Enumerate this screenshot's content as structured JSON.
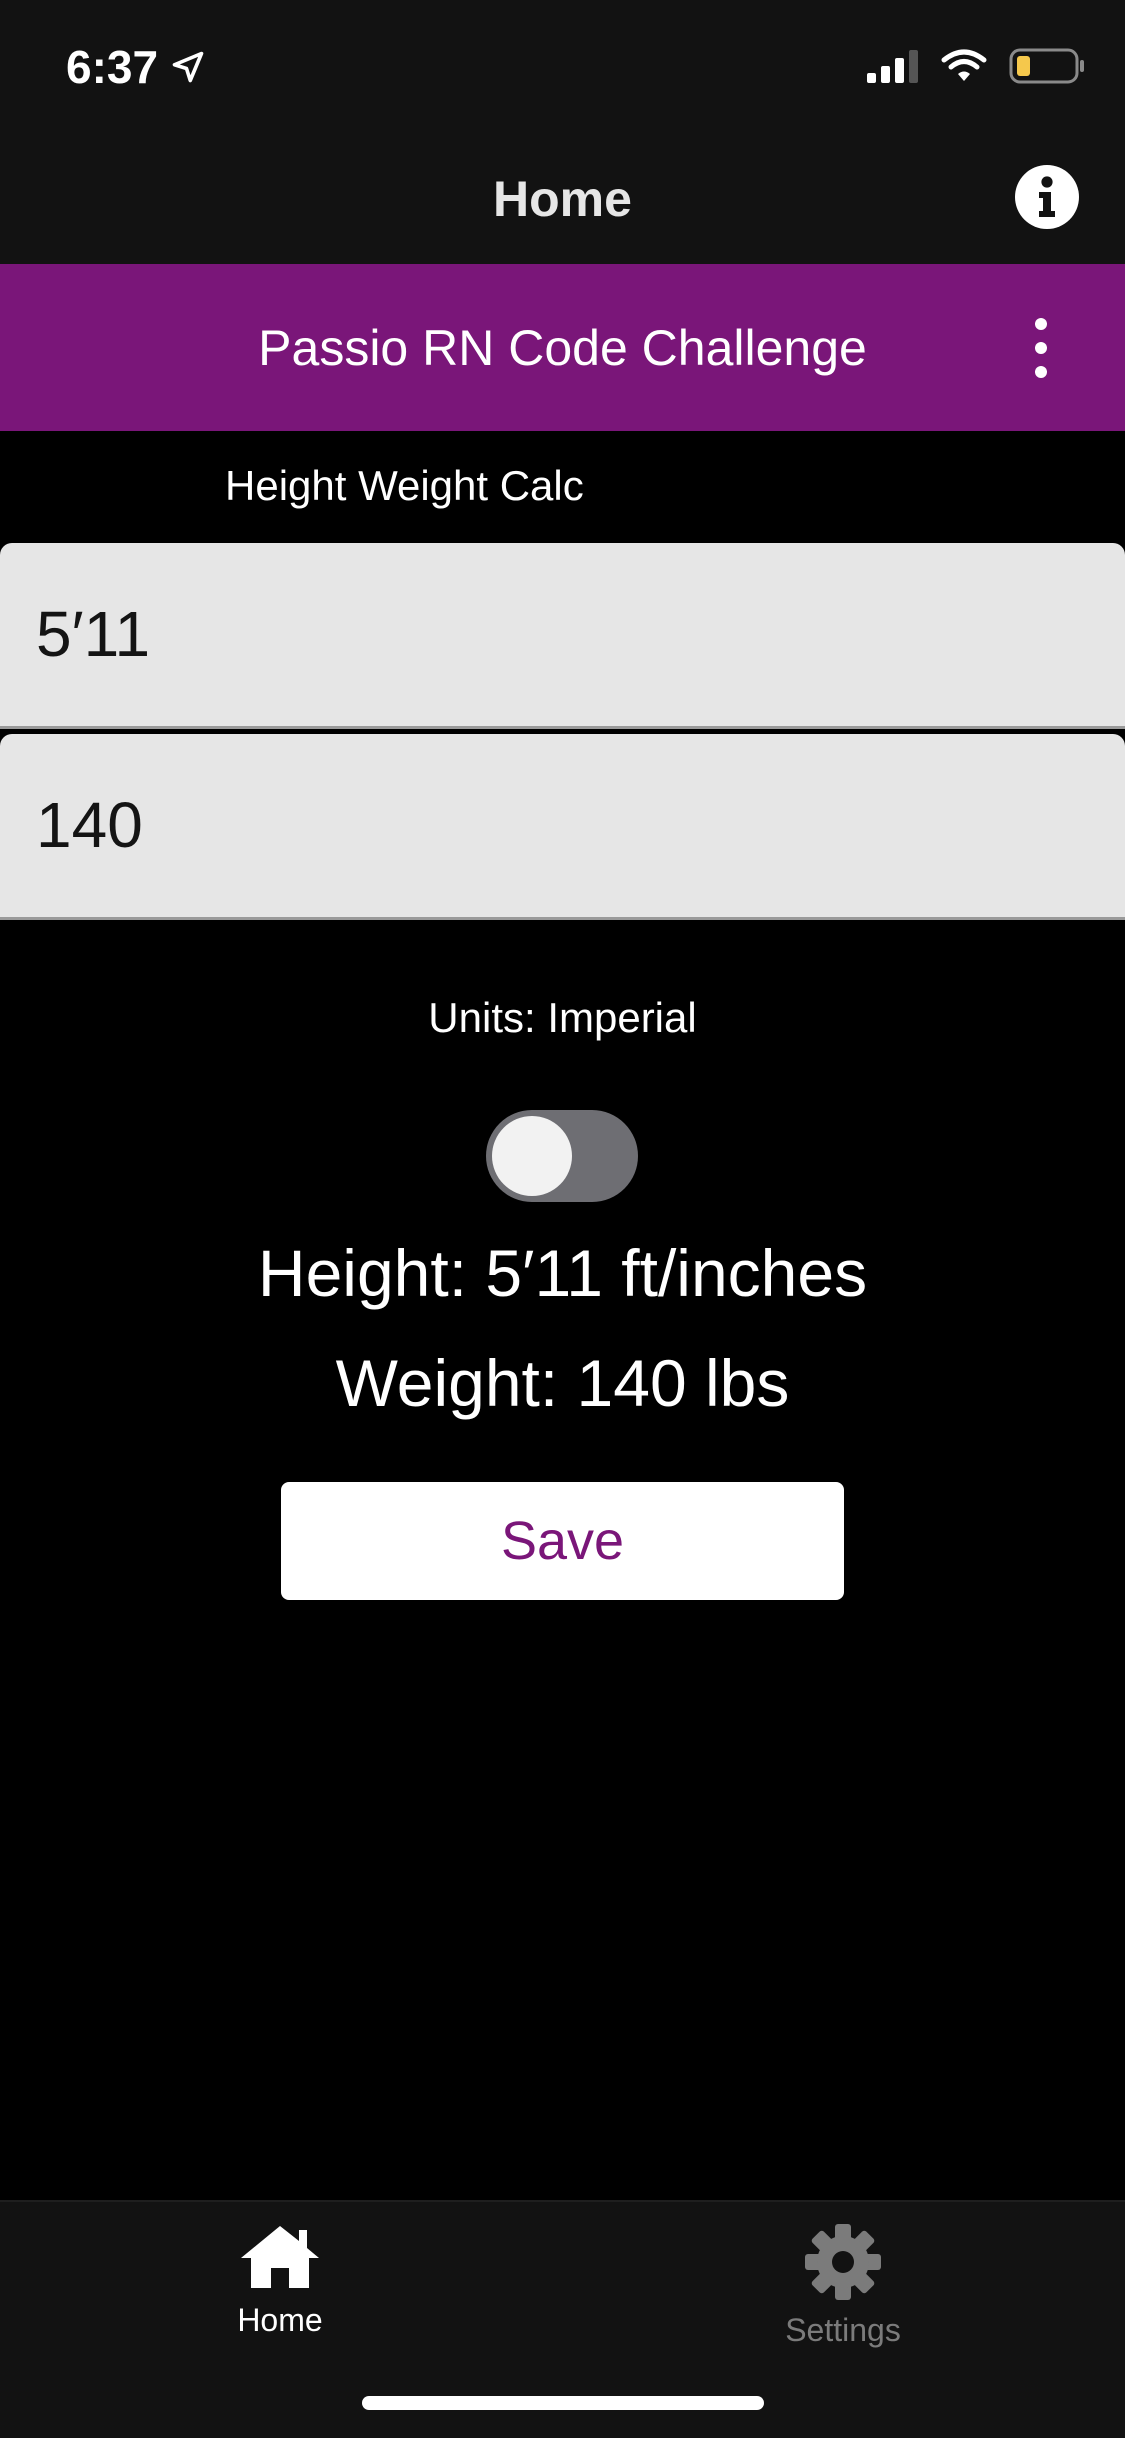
{
  "status_bar": {
    "time": "6:37"
  },
  "header": {
    "title": "Home",
    "info_icon": "info-icon"
  },
  "app_bar": {
    "title": "Passio RN Code Challenge",
    "menu_icon": "more-vertical-icon"
  },
  "form": {
    "section_label": "Height Weight Calc",
    "height_value": "5′11",
    "weight_value": "140",
    "units_label": "Units: Imperial",
    "units_toggle_on": false
  },
  "results": {
    "height_text": "Height: 5′11 ft/inches",
    "weight_text": "Weight: 140 lbs"
  },
  "actions": {
    "save_label": "Save"
  },
  "tabs": [
    {
      "label": "Home",
      "icon": "home-icon",
      "active": true
    },
    {
      "label": "Settings",
      "icon": "gear-icon",
      "active": false
    }
  ],
  "colors": {
    "accent": "#7a1679",
    "background": "#000000",
    "bar": "#121212",
    "field": "#e6e6e6",
    "battery": "#f5c84c"
  }
}
